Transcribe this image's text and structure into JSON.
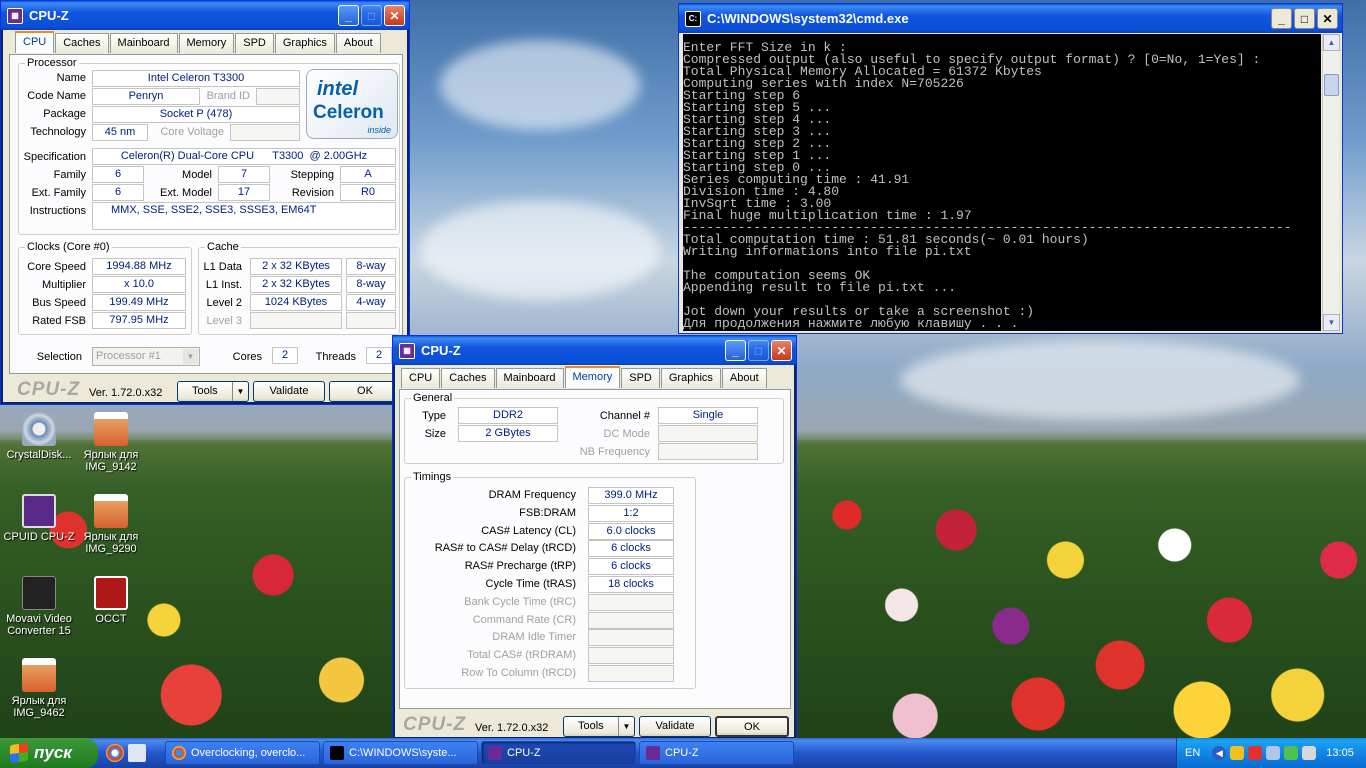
{
  "desktop": {
    "icons": [
      {
        "label": "CrystalDisk..."
      },
      {
        "label": "Ярлык для IMG_9142"
      },
      {
        "label": "CPUID CPU-Z"
      },
      {
        "label": "Ярлык для IMG_9290"
      },
      {
        "label": "Movavi Video Converter 15"
      },
      {
        "label": "OCCT"
      },
      {
        "label": "Ярлык для IMG_9462"
      }
    ]
  },
  "cpuz1": {
    "title": "CPU-Z",
    "tabs": [
      "CPU",
      "Caches",
      "Mainboard",
      "Memory",
      "SPD",
      "Graphics",
      "About"
    ],
    "processor": {
      "group": "Processor",
      "name_label": "Name",
      "name": "Intel Celeron T3300",
      "codename_label": "Code Name",
      "codename": "Penryn",
      "brandid_label": "Brand ID",
      "package_label": "Package",
      "package": "Socket P (478)",
      "tech_label": "Technology",
      "tech": "45 nm",
      "corevolt_label": "Core Voltage",
      "spec_label": "Specification",
      "spec": "Celeron(R) Dual-Core CPU      T3300  @ 2.00GHz",
      "family_label": "Family",
      "family": "6",
      "model_label": "Model",
      "model": "7",
      "stepping_label": "Stepping",
      "stepping": "A",
      "extfamily_label": "Ext. Family",
      "extfamily": "6",
      "extmodel_label": "Ext. Model",
      "extmodel": "17",
      "revision_label": "Revision",
      "revision": "R0",
      "instr_label": "Instructions",
      "instr": "MMX, SSE, SSE2, SSE3, SSSE3, EM64T",
      "logo_brand": "intel",
      "logo_line": "Celeron",
      "logo_inside": "inside"
    },
    "clocks": {
      "group": "Clocks (Core #0)",
      "corespeed_label": "Core Speed",
      "corespeed": "1994.88 MHz",
      "multiplier_label": "Multiplier",
      "multiplier": "x 10.0",
      "busspeed_label": "Bus Speed",
      "busspeed": "199.49 MHz",
      "ratedfsb_label": "Rated FSB",
      "ratedfsb": "797.95 MHz"
    },
    "cache": {
      "group": "Cache",
      "l1d_label": "L1 Data",
      "l1d": "2 x 32 KBytes",
      "l1d_way": "8-way",
      "l1i_label": "L1 Inst.",
      "l1i": "2 x 32 KBytes",
      "l1i_way": "8-way",
      "l2_label": "Level 2",
      "l2": "1024 KBytes",
      "l2_way": "4-way",
      "l3_label": "Level 3"
    },
    "selection_label": "Selection",
    "selection_value": "Processor #1",
    "cores_label": "Cores",
    "cores": "2",
    "threads_label": "Threads",
    "threads": "2",
    "footer": {
      "logo": "CPU-Z",
      "version": "Ver. 1.72.0.x32",
      "tools": "Tools",
      "validate": "Validate",
      "ok": "OK"
    }
  },
  "cpuz2": {
    "title": "CPU-Z",
    "tabs": [
      "CPU",
      "Caches",
      "Mainboard",
      "Memory",
      "SPD",
      "Graphics",
      "About"
    ],
    "general": {
      "group": "General",
      "type_label": "Type",
      "type": "DDR2",
      "size_label": "Size",
      "size": "2 GBytes",
      "channel_label": "Channel #",
      "channel": "Single",
      "dcmode_label": "DC Mode",
      "nbfreq_label": "NB Frequency"
    },
    "timings": {
      "group": "Timings",
      "rows": [
        {
          "label": "DRAM Frequency",
          "value": "399.0 MHz"
        },
        {
          "label": "FSB:DRAM",
          "value": "1:2"
        },
        {
          "label": "CAS# Latency (CL)",
          "value": "6.0 clocks"
        },
        {
          "label": "RAS# to CAS# Delay (tRCD)",
          "value": "6 clocks"
        },
        {
          "label": "RAS# Precharge (tRP)",
          "value": "6 clocks"
        },
        {
          "label": "Cycle Time (tRAS)",
          "value": "18 clocks"
        },
        {
          "label": "Bank Cycle Time (tRC)",
          "value": ""
        },
        {
          "label": "Command Rate (CR)",
          "value": ""
        },
        {
          "label": "DRAM Idle Timer",
          "value": ""
        },
        {
          "label": "Total CAS# (tRDRAM)",
          "value": ""
        },
        {
          "label": "Row To Column (tRCD)",
          "value": ""
        }
      ]
    },
    "footer": {
      "logo": "CPU-Z",
      "version": "Ver. 1.72.0.x32",
      "tools": "Tools",
      "validate": "Validate",
      "ok": "OK"
    }
  },
  "cmd": {
    "title": "C:\\WINDOWS\\system32\\cmd.exe",
    "lines": [
      "Enter FFT Size in k :",
      "Compressed output (also useful to specify output format) ? [0=No, 1=Yes] :",
      "Total Physical Memory Allocated = 61372 Kbytes",
      "Computing series with index N=705226",
      "Starting step 6",
      "Starting step 5 ...",
      "Starting step 4 ...",
      "Starting step 3 ...",
      "Starting step 2 ...",
      "Starting step 1 ...",
      "Starting step 0 ...",
      "Series computing time : 41.91",
      "Division time : 4.80",
      "InvSqrt time : 3.00",
      "Final huge multiplication time : 1.97",
      "------------------------------------------------------------------------------",
      "Total computation time : 51.81 seconds(~ 0.01 hours)",
      "Writing informations into file pi.txt",
      "",
      "The computation seems OK",
      "Appending result to file pi.txt ...",
      "",
      "Jot down your results or take a screenshot :)",
      "Для продолжения нажмите любую клавишу . . ."
    ]
  },
  "taskbar": {
    "start": "пуск",
    "tasks": [
      "Overclocking, overclo...",
      "C:\\WINDOWS\\syste...",
      "CPU-Z",
      "CPU-Z"
    ],
    "lang": "EN",
    "clock": "13:05"
  }
}
